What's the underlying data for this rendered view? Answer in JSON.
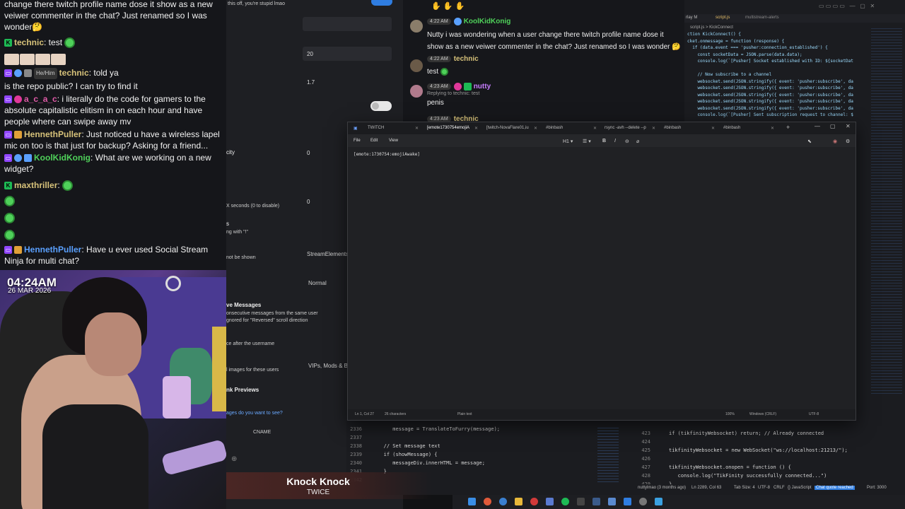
{
  "chat": {
    "messages": [
      {
        "user": "",
        "text": "change there twitch profile name dose it show as a new veiwer commenter in the chat? Just renamed so I was wonder🤔"
      },
      {
        "user": "technic",
        "text": ": test"
      },
      {
        "user": "technic",
        "pronoun": "He/Him",
        "text": ": told ya"
      },
      {
        "user": "",
        "text": "is the repo public? I can try to find it"
      },
      {
        "user": "a_c_a_c",
        "text": ": i literally do the code for gamers to the absolute capitalistic elitism in on each hour and have people where can swipe away mv"
      },
      {
        "user": "HennethPuller",
        "text": ": Just noticed u have a wireless lapel mic on too is that just for backup? Asking for a friend..."
      },
      {
        "user": "KoolKidKonig",
        "text": ": What are we working on a new widget?"
      },
      {
        "user": "maxthriller",
        "text": ":"
      },
      {
        "user": "HennethPuller",
        "text": ": Have u ever used Social Stream Ninja for multi chat?"
      }
    ]
  },
  "clock": {
    "time": "04:24AM",
    "date": "26 MAR 2026"
  },
  "settings": {
    "top_text": "this off, you're stupid lmao",
    "values": [
      "20",
      "1.7",
      "0",
      "0"
    ],
    "labels": {
      "city": "city",
      "seconds": "X seconds (0 to disable)",
      "s": "s",
      "ng_with": "ng with \"!\"",
      "not_shown": "not be shown",
      "stream_elements": "StreamElements",
      "normal": "Normal",
      "ve_messages": "ve Messages",
      "consecutive": "onsecutive messages from the same user",
      "ignored": "gnored for \"Reversed\" scroll direction",
      "after_username": "ce after the username",
      "images_users": "l images for these users",
      "vips": "VIPs, Mods & B",
      "link_previews": "nk Previews",
      "ages_question": "ages do you want to see?",
      "cname": "CNAME"
    }
  },
  "right_chat": {
    "msgs": [
      {
        "time": "4:22 AM",
        "user": "KoolKidKonig",
        "text": "Nutty i was wondering when a user change there twitch profile name dose it show as a new veiwer commenter in the chat? Just renamed so I was wonder 🤔"
      },
      {
        "time": "4:22 AM",
        "user": "technic",
        "text": "test"
      },
      {
        "time": "4:23 AM",
        "user": "nutty",
        "reply": "Replying to technic: test",
        "text": "penis"
      },
      {
        "time": "4:23 AM",
        "user": "technic",
        "text": ""
      }
    ]
  },
  "vscode": {
    "tabs": [
      "rlay M",
      "script.js",
      "multistream-alerts"
    ],
    "breadcrumb": "script.js > KickConnect",
    "lines": [
      "ction KickConnect() {",
      "cket.onmessage = function (response) {",
      "  if (data.event === 'pusher:connection_established') {",
      "    const socketData = JSON.parse(data.data);",
      "    console.log(`[Pusher] Socket established with ID: ${socketDat",
      "",
      "    // Now subscribe to a channel",
      "    websocket.send(JSON.stringify({ event: 'pusher:subscribe', da",
      "    websocket.send(JSON.stringify({ event: 'pusher:subscribe', da",
      "    websocket.send(JSON.stringify({ event: 'pusher:subscribe', da",
      "    websocket.send(JSON.stringify({ event: 'pusher:subscribe', da",
      "    websocket.send(JSON.stringify({ event: 'pusher:subscribe', da",
      "    console.log(`[Pusher] Sent subscription request to channel: $"
    ]
  },
  "bottom_code": {
    "left_lines": [
      {
        "n": "2336",
        "code": "      message = TranslateToFurry(message);"
      },
      {
        "n": "2337",
        "code": ""
      },
      {
        "n": "2338",
        "code": "   // Set message text"
      },
      {
        "n": "2339",
        "code": "   if (showMessage) {"
      },
      {
        "n": "2340",
        "code": "      messageDiv.innerHTML = message;"
      },
      {
        "n": "2341",
        "code": "   }"
      },
      {
        "n": "2342",
        "code": ""
      }
    ],
    "right_lines": [
      {
        "n": "423",
        "code": "if (tikfinityWebsocket) return; // Already connected"
      },
      {
        "n": "424",
        "code": ""
      },
      {
        "n": "425",
        "code": "tikfinityWebsocket = new WebSocket(\"ws://localhost:21213/\");"
      },
      {
        "n": "426",
        "code": ""
      },
      {
        "n": "427",
        "code": "tikfinityWebsocket.onopen = function () {"
      },
      {
        "n": "428",
        "code": "   console.log(\"TikFinity successfully connected...\")"
      },
      {
        "n": "429",
        "code": "}"
      }
    ],
    "status": [
      "nuttylmao (3 months ago)",
      "Ln 2289, Col 63",
      "Tab Size: 4",
      "UTF-8",
      "CRLF",
      "{} JavaScript",
      "Chat quote reached",
      "Port: 3000"
    ]
  },
  "notepad": {
    "tabs": [
      "TWITCH",
      "[emote1730754emojiA",
      "[twitch-NovaFlare01,iu",
      "#binbash",
      "rsync -avh --delete --p",
      "#binbash",
      "#binbash"
    ],
    "menu": [
      "File",
      "Edit",
      "View"
    ],
    "heading_select": "H1",
    "content": "[emote:1730754:emojiAwake]",
    "status": {
      "pos": "Ln 1, Col 27",
      "chars": "26 characters",
      "format": "Plain text",
      "zoom": "100%",
      "eol": "Windows (CRLF)",
      "enc": "UTF-8"
    }
  },
  "now_playing": {
    "song": "Knock Knock",
    "artist": "TWICE"
  },
  "colors": {
    "kick": "#1db954",
    "twitch": "#9146ff",
    "accent": "#2f7de1",
    "now_playing": "#4a2624"
  }
}
